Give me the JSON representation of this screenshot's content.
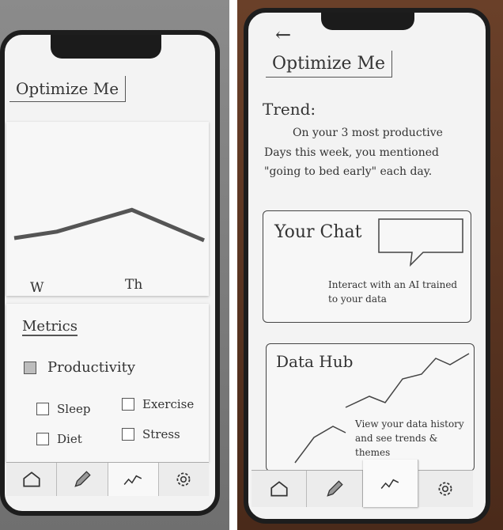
{
  "left_mockup": {
    "app_title": "Optimize Me",
    "chart_data": {
      "type": "line",
      "categories": [
        "W",
        "Th"
      ],
      "values": [
        2,
        3
      ],
      "title": "",
      "xlabel": "",
      "ylabel": ""
    },
    "metrics": {
      "heading": "Metrics",
      "items": [
        {
          "label": "Productivity",
          "checked": true
        },
        {
          "label": "Sleep",
          "checked": false
        },
        {
          "label": "Exercise",
          "checked": false
        },
        {
          "label": "Diet",
          "checked": false
        },
        {
          "label": "Stress",
          "checked": false
        }
      ]
    },
    "tabs": [
      "home-icon",
      "pencil-icon",
      "trend-icon",
      "gear-icon"
    ]
  },
  "right_mockup": {
    "back_glyph": "←",
    "app_title": "Optimize Me",
    "trend_heading": "Trend:",
    "trend_text": "On your 3 most productive Days this week, you mentioned \"going to bed early\" each day.",
    "your_chat": {
      "title": "Your Chat",
      "desc": "Interact with an AI trained to your data"
    },
    "data_hub": {
      "title": "Data Hub",
      "desc": "View your data history and see trends & themes"
    },
    "tabs": [
      "home-icon",
      "pencil-icon",
      "trend-icon",
      "gear-icon"
    ]
  }
}
